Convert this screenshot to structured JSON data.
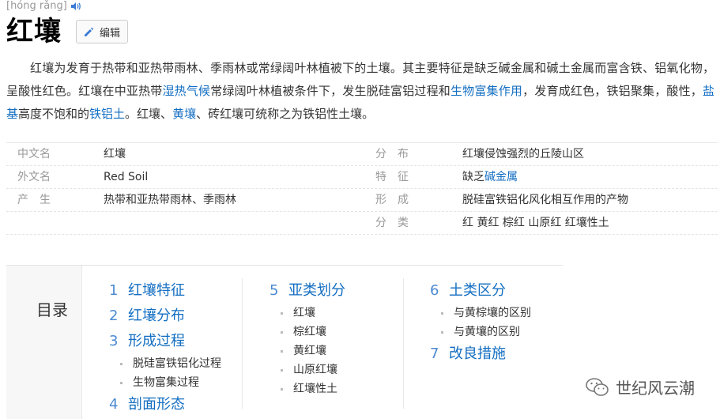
{
  "header": {
    "pinyin": "[hóng rǎng]",
    "title": "红壤",
    "edit_label": "编辑"
  },
  "intro": {
    "p1": "红壤为发育于热带和亚热带雨林、季雨林或常绿阔叶林植被下的土壤。其主要特征是缺乏碱金属和碱土金属而富含铁、铝氧化物，呈酸性红色。红壤在中亚热带",
    "link1": "湿热气候",
    "p2": "常绿阔叶林植被条件下，发生脱硅富铝过程和",
    "link2": "生物富集作用",
    "p3": "，发育成红色，铁铝聚集，酸性，",
    "link3": "盐基",
    "p4": "高度不饱和的",
    "link4": "铁铝土",
    "p5": "。红壤、",
    "link5": "黄壤",
    "p6": "、砖红壤可统称之为铁铝性土壤。"
  },
  "infobox": {
    "rows": [
      {
        "l_label": "中文名",
        "l_value": "红壤",
        "r_label": "分　布",
        "r_value": "红壤侵蚀强烈的丘陵山区"
      },
      {
        "l_label": "外文名",
        "l_value": "Red Soil",
        "r_label": "特　征",
        "r_value_pre": "缺乏",
        "r_value_link": "碱金属"
      },
      {
        "l_label": "产　生",
        "l_value": "热带和亚热带雨林、季雨林",
        "r_label": "形　成",
        "r_value": "脱硅富铁铝化风化相互作用的产物"
      },
      {
        "r_label": "分　类",
        "r_value": "红 黄红 棕红 山原红 红壤性土"
      }
    ]
  },
  "toc": {
    "heading": "目录",
    "col1": [
      {
        "num": "1",
        "label": "红壤特征"
      },
      {
        "num": "2",
        "label": "红壤分布"
      },
      {
        "num": "3",
        "label": "形成过程"
      },
      {
        "sub": "脱硅富铁铝化过程"
      },
      {
        "sub": "生物富集过程"
      },
      {
        "num": "4",
        "label": "剖面形态"
      }
    ],
    "col2": [
      {
        "num": "5",
        "label": "亚类划分"
      },
      {
        "sub": "红壤"
      },
      {
        "sub": "棕红壤"
      },
      {
        "sub": "黄红壤"
      },
      {
        "sub": "山原红壤"
      },
      {
        "sub": "红壤性土"
      }
    ],
    "col3": [
      {
        "num": "6",
        "label": "土类区分"
      },
      {
        "sub": "与黄棕壤的区别"
      },
      {
        "sub": "与黄壤的区别"
      },
      {
        "num": "7",
        "label": "改良措施"
      }
    ]
  },
  "watermark": {
    "text": "世纪风云潮"
  },
  "colors": {
    "link": "#136ec2",
    "toc_number": "#4c8ad2",
    "label_gray": "#999999"
  }
}
